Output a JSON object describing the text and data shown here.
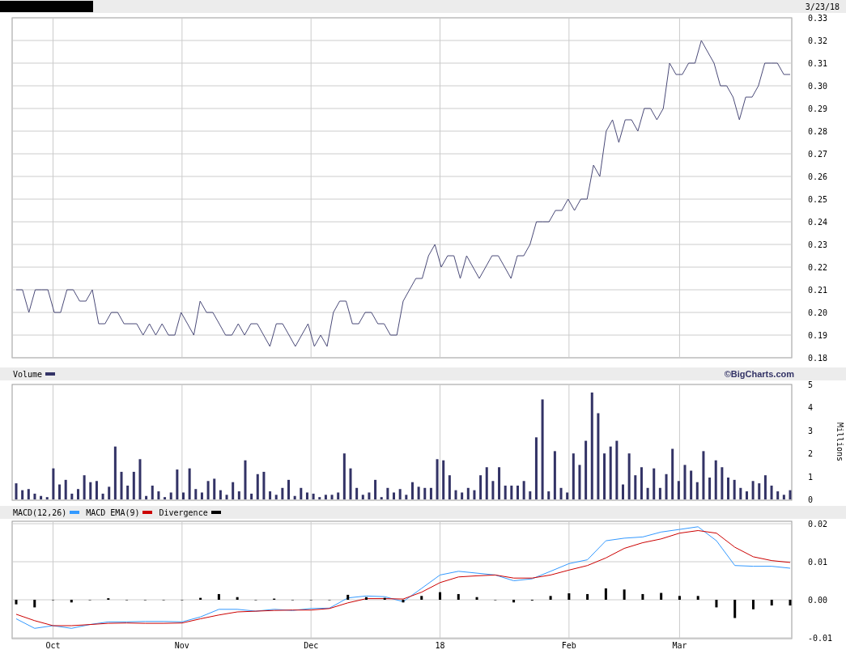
{
  "header": {
    "date": "3/23/18"
  },
  "price_chart": {
    "chart_data": {
      "type": "line",
      "grid": true,
      "ylim": [
        0.18,
        0.33
      ],
      "yticks": [
        {
          "value": 0.33,
          "label": "0.33"
        },
        {
          "value": 0.32,
          "label": "0.32"
        },
        {
          "value": 0.31,
          "label": "0.31"
        },
        {
          "value": 0.3,
          "label": "0.30"
        },
        {
          "value": 0.29,
          "label": "0.29"
        },
        {
          "value": 0.28,
          "label": "0.28"
        },
        {
          "value": 0.27,
          "label": "0.27"
        },
        {
          "value": 0.26,
          "label": "0.26"
        },
        {
          "value": 0.25,
          "label": "0.25"
        },
        {
          "value": 0.24,
          "label": "0.24"
        },
        {
          "value": 0.23,
          "label": "0.23"
        },
        {
          "value": 0.22,
          "label": "0.22"
        },
        {
          "value": 0.21,
          "label": "0.21"
        },
        {
          "value": 0.2,
          "label": "0.20"
        },
        {
          "value": 0.19,
          "label": "0.19"
        },
        {
          "value": 0.18,
          "label": "0.18"
        }
      ],
      "series": [
        {
          "color": "#4a4a78",
          "values": [
            0.21,
            0.21,
            0.2,
            0.21,
            0.21,
            0.21,
            0.2,
            0.2,
            0.21,
            0.21,
            0.205,
            0.205,
            0.21,
            0.195,
            0.195,
            0.2,
            0.2,
            0.195,
            0.195,
            0.195,
            0.19,
            0.195,
            0.19,
            0.195,
            0.19,
            0.19,
            0.2,
            0.195,
            0.19,
            0.205,
            0.2,
            0.2,
            0.195,
            0.19,
            0.19,
            0.195,
            0.19,
            0.195,
            0.195,
            0.19,
            0.185,
            0.195,
            0.195,
            0.19,
            0.185,
            0.19,
            0.195,
            0.185,
            0.19,
            0.185,
            0.2,
            0.205,
            0.205,
            0.195,
            0.195,
            0.2,
            0.2,
            0.195,
            0.195,
            0.19,
            0.19,
            0.205,
            0.21,
            0.215,
            0.215,
            0.225,
            0.23,
            0.22,
            0.225,
            0.225,
            0.215,
            0.225,
            0.22,
            0.215,
            0.22,
            0.225,
            0.225,
            0.22,
            0.215,
            0.225,
            0.225,
            0.23,
            0.24,
            0.24,
            0.24,
            0.245,
            0.245,
            0.25,
            0.245,
            0.25,
            0.25,
            0.265,
            0.26,
            0.28,
            0.285,
            0.275,
            0.285,
            0.285,
            0.28,
            0.29,
            0.29,
            0.285,
            0.29,
            0.31,
            0.305,
            0.305,
            0.31,
            0.31,
            0.32,
            0.315,
            0.31,
            0.3,
            0.3,
            0.295,
            0.285,
            0.295,
            0.295,
            0.3,
            0.31,
            0.31,
            0.31,
            0.305,
            0.305
          ]
        }
      ]
    }
  },
  "volume_chart": {
    "brand": "©BigCharts.com",
    "chart_data": {
      "type": "bar",
      "grid": true,
      "ylabel": "Millions",
      "ylim": [
        0,
        5
      ],
      "yticks": [
        {
          "value": 5,
          "label": "5"
        },
        {
          "value": 4,
          "label": "4"
        },
        {
          "value": 3,
          "label": "3"
        },
        {
          "value": 2,
          "label": "2"
        },
        {
          "value": 1,
          "label": "1"
        },
        {
          "value": 0,
          "label": "0"
        }
      ],
      "series": [
        {
          "name": "Volume",
          "color": "#333366",
          "values": [
            0.7,
            0.4,
            0.45,
            0.25,
            0.15,
            0.1,
            1.35,
            0.65,
            0.85,
            0.25,
            0.45,
            1.05,
            0.75,
            0.8,
            0.25,
            0.55,
            2.3,
            1.2,
            0.6,
            1.2,
            1.75,
            0.15,
            0.6,
            0.35,
            0.1,
            0.3,
            1.3,
            0.3,
            1.35,
            0.45,
            0.3,
            0.8,
            0.9,
            0.4,
            0.2,
            0.75,
            0.35,
            1.7,
            0.25,
            1.1,
            1.2,
            0.35,
            0.2,
            0.5,
            0.85,
            0.15,
            0.5,
            0.3,
            0.25,
            0.1,
            0.2,
            0.2,
            0.3,
            2.0,
            1.35,
            0.5,
            0.2,
            0.3,
            0.85,
            0.1,
            0.5,
            0.3,
            0.45,
            0.2,
            0.75,
            0.55,
            0.5,
            0.5,
            1.75,
            1.7,
            1.05,
            0.4,
            0.3,
            0.5,
            0.4,
            1.05,
            1.4,
            0.8,
            1.4,
            0.6,
            0.6,
            0.6,
            0.8,
            0.35,
            2.7,
            4.35,
            0.35,
            2.1,
            0.5,
            0.3,
            2.0,
            1.5,
            2.55,
            4.65,
            3.75,
            2.0,
            2.3,
            2.55,
            0.65,
            2.0,
            1.05,
            1.4,
            0.5,
            1.35,
            0.5,
            1.1,
            2.2,
            0.8,
            1.5,
            1.25,
            0.75,
            2.1,
            0.95,
            1.7,
            1.4,
            0.95,
            0.85,
            0.5,
            0.35,
            0.8,
            0.7,
            1.05,
            0.6,
            0.35,
            0.2,
            0.4
          ]
        }
      ]
    }
  },
  "macd_chart": {
    "chart_data": {
      "type": "line",
      "grid": true,
      "ylim": [
        -0.01,
        0.02
      ],
      "yticks": [
        {
          "value": 0.02,
          "label": "0.02"
        },
        {
          "value": 0.01,
          "label": "0.01"
        },
        {
          "value": 0,
          "label": "0.00"
        },
        {
          "value": -0.01,
          "label": "-0.01"
        }
      ],
      "categories": [
        null,
        null,
        "Oct",
        null,
        null,
        null,
        null,
        null,
        null,
        "Nov",
        null,
        null,
        null,
        null,
        null,
        null,
        "Dec",
        null,
        null,
        null,
        null,
        null,
        null,
        "18",
        null,
        null,
        null,
        null,
        null,
        null,
        "Feb",
        null,
        null,
        null,
        null,
        null,
        "Mar",
        null,
        null,
        null,
        null,
        null,
        null
      ],
      "series": [
        {
          "name": "MACD(12,26)",
          "color": "#3399ff",
          "values": [
            -0.005,
            -0.0075,
            -0.0068,
            -0.0075,
            -0.0065,
            -0.0058,
            -0.0058,
            -0.0057,
            -0.0057,
            -0.0058,
            -0.0045,
            -0.0025,
            -0.0025,
            -0.003,
            -0.0025,
            -0.0028,
            -0.0023,
            -0.0022,
            0.0005,
            0.001,
            0.0008,
            -0.0005,
            0.003,
            0.0065,
            0.0075,
            0.007,
            0.0065,
            0.005,
            0.0055,
            0.0075,
            0.0095,
            0.0105,
            0.0155,
            0.0162,
            0.0165,
            0.0178,
            0.0185,
            0.0192,
            0.0155,
            0.009,
            0.0088,
            0.0088,
            0.0083
          ]
        },
        {
          "name": "MACD EMA(9)",
          "color": "#cc0000",
          "values": [
            -0.0038,
            -0.0055,
            -0.0068,
            -0.0068,
            -0.0065,
            -0.0062,
            -0.0061,
            -0.0062,
            -0.0062,
            -0.0061,
            -0.005,
            -0.004,
            -0.0032,
            -0.003,
            -0.0028,
            -0.0027,
            -0.0027,
            -0.0023,
            -0.0008,
            0.0003,
            0.0003,
            0.0002,
            0.002,
            0.0045,
            0.006,
            0.0063,
            0.0065,
            0.0057,
            0.0057,
            0.0065,
            0.0078,
            0.009,
            0.011,
            0.0135,
            0.015,
            0.016,
            0.0175,
            0.0182,
            0.0175,
            0.0138,
            0.0113,
            0.0103,
            0.0098
          ]
        }
      ]
    },
    "divergence": {
      "chart_data": {
        "type": "bar",
        "ylim": [
          -0.01,
          0.02
        ],
        "series": [
          {
            "name": "Divergence",
            "color": "#000000",
            "values": [
              -0.0012,
              -0.002,
              0,
              -0.0007,
              0,
              0.0004,
              0,
              0,
              0,
              0,
              0.0005,
              0.0015,
              0.0007,
              0,
              0.0003,
              -0.0001,
              0,
              -0.0001,
              0.0013,
              0.0007,
              0.0005,
              -0.0007,
              0.001,
              0.002,
              0.0015,
              0.0007,
              0,
              -0.0007,
              -0.0002,
              0.001,
              0.0017,
              0.0015,
              0.003,
              0.0027,
              0.0015,
              0.0018,
              0.001,
              0.001,
              -0.002,
              -0.0048,
              -0.0025,
              -0.0015,
              -0.0015
            ]
          }
        ]
      }
    }
  }
}
